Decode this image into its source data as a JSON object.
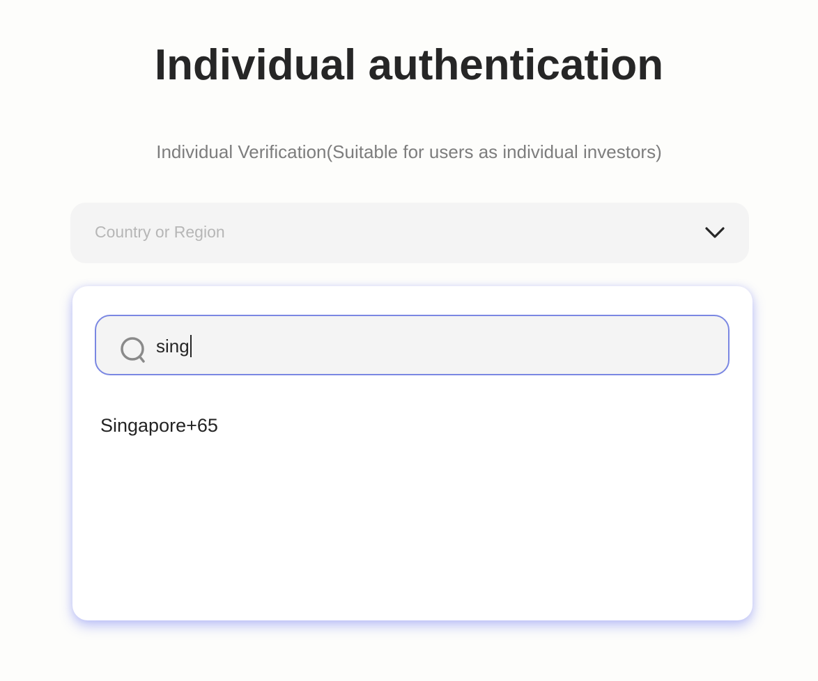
{
  "header": {
    "title": "Individual authentication",
    "subtitle": "Individual Verification(Suitable for users as individual investors)"
  },
  "country_select": {
    "placeholder": "Country or Region",
    "icon": "chevron-down-icon"
  },
  "dropdown": {
    "search": {
      "value": "sing",
      "icon": "search-icon",
      "border_color": "#7a87e2"
    },
    "options": [
      {
        "label": "Singapore+65"
      }
    ]
  }
}
